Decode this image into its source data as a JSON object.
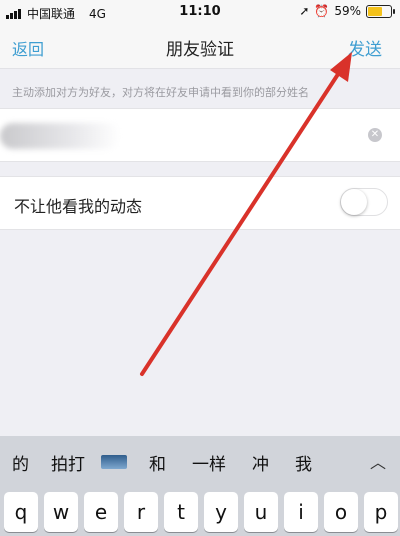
{
  "status": {
    "carrier": "中国联通",
    "network": "4G",
    "time": "11:10",
    "battery_percent": "59%",
    "battery_level": 0.59
  },
  "nav": {
    "back_label": "返回",
    "title": "朋友验证",
    "send_label": "发送"
  },
  "hint": "主动添加对方为好友，对方将在好友申请中看到你的部分姓名",
  "name_field": {
    "value": ""
  },
  "privacy_row": {
    "label": "不让他看我的动态",
    "toggle_on": false
  },
  "keyboard": {
    "candidates": [
      "的",
      "拍打",
      "和",
      "一样",
      "冲",
      "我"
    ],
    "keys": [
      "q",
      "w",
      "e",
      "r",
      "t",
      "y",
      "u",
      "i",
      "o",
      "p"
    ]
  },
  "colors": {
    "accent": "#3f9ed1",
    "arrow": "#d9322a"
  }
}
